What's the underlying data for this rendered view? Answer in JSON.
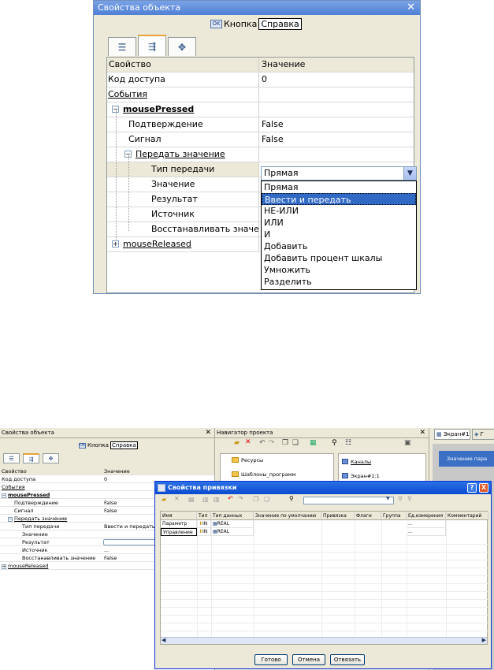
{
  "top_panel": {
    "title": "Свойства объекта",
    "header_object": "Кнопка",
    "header_help": "Справка",
    "ok_icon_text": "OK",
    "tabs": [
      {
        "icon": "list-icon"
      },
      {
        "icon": "events-icon",
        "active": true
      },
      {
        "icon": "connections-icon"
      }
    ],
    "grid": {
      "col_property": "Свойство",
      "col_value": "Значение",
      "rows": [
        {
          "label": "Код доступа",
          "value": "0"
        },
        {
          "label": "События",
          "value": ""
        },
        {
          "label": "mousePressed",
          "value": ""
        },
        {
          "label": "Подтверждение",
          "value": "False"
        },
        {
          "label": "Сигнал",
          "value": "False"
        },
        {
          "label": "Передать значение",
          "value": ""
        },
        {
          "label": "Тип передачи",
          "value": "Прямая"
        },
        {
          "label": "Значение",
          "value": ""
        },
        {
          "label": "Результат",
          "value": ""
        },
        {
          "label": "Источник",
          "value": ""
        },
        {
          "label": "Восстанавливать значение",
          "value": ""
        },
        {
          "label": "mouseReleased",
          "value": ""
        }
      ]
    },
    "dropdown_options": [
      "Прямая",
      "Ввести и передать",
      "НЕ-ИЛИ",
      "ИЛИ",
      "И",
      "Добавить",
      "Добавить процент шкалы",
      "Умножить",
      "Разделить"
    ],
    "dropdown_highlighted": "Ввести и передать"
  },
  "bottom": {
    "props_panel": {
      "title": "Свойства объекта",
      "header_object": "Кнопка",
      "header_help": "Справка",
      "col_property": "Свойство",
      "col_value": "Значение",
      "rows": [
        {
          "label": "Код доступа",
          "value": "0"
        },
        {
          "label": "События",
          "value": ""
        },
        {
          "label": "mousePressed",
          "value": ""
        },
        {
          "label": "Подтверждение",
          "value": "False"
        },
        {
          "label": "Сигнал",
          "value": "False"
        },
        {
          "label": "Передать значение",
          "value": ""
        },
        {
          "label": "Тип передачи",
          "value": "Ввести и передать"
        },
        {
          "label": "Значение",
          "value": ""
        },
        {
          "label": "Результат",
          "value": ""
        },
        {
          "label": "Источник",
          "value": "..."
        },
        {
          "label": "Восстанавливать значение",
          "value": "False"
        },
        {
          "label": "mouseReleased",
          "value": ""
        }
      ]
    },
    "navigator": {
      "title": "Навигатор проекта",
      "tree": [
        "Ресурсы",
        "Шаблоны_программ"
      ],
      "list": [
        "Каналы",
        "Экран#1:1"
      ]
    },
    "screen_tabs": [
      "Экран#1*",
      "Г"
    ],
    "screen_button": "Значение пара",
    "dialog": {
      "title": "Свойства привязки",
      "columns": [
        "Имя",
        "Тип",
        "Тип данных",
        "Значение по умолчанию",
        "Привязка",
        "Флаги",
        "Группа",
        "Ед.измерения",
        "Комментарий"
      ],
      "rows": [
        {
          "name": "Параметр",
          "type": "IN",
          "data_type": "REAL",
          "unit": "..."
        },
        {
          "name": "Управление",
          "type": "IN",
          "data_type": "REAL",
          "unit": "..."
        }
      ],
      "buttons": {
        "done": "Готово",
        "cancel": "Отмена",
        "unbind": "Отвязать"
      },
      "title_help": "?",
      "title_close": "X"
    }
  }
}
